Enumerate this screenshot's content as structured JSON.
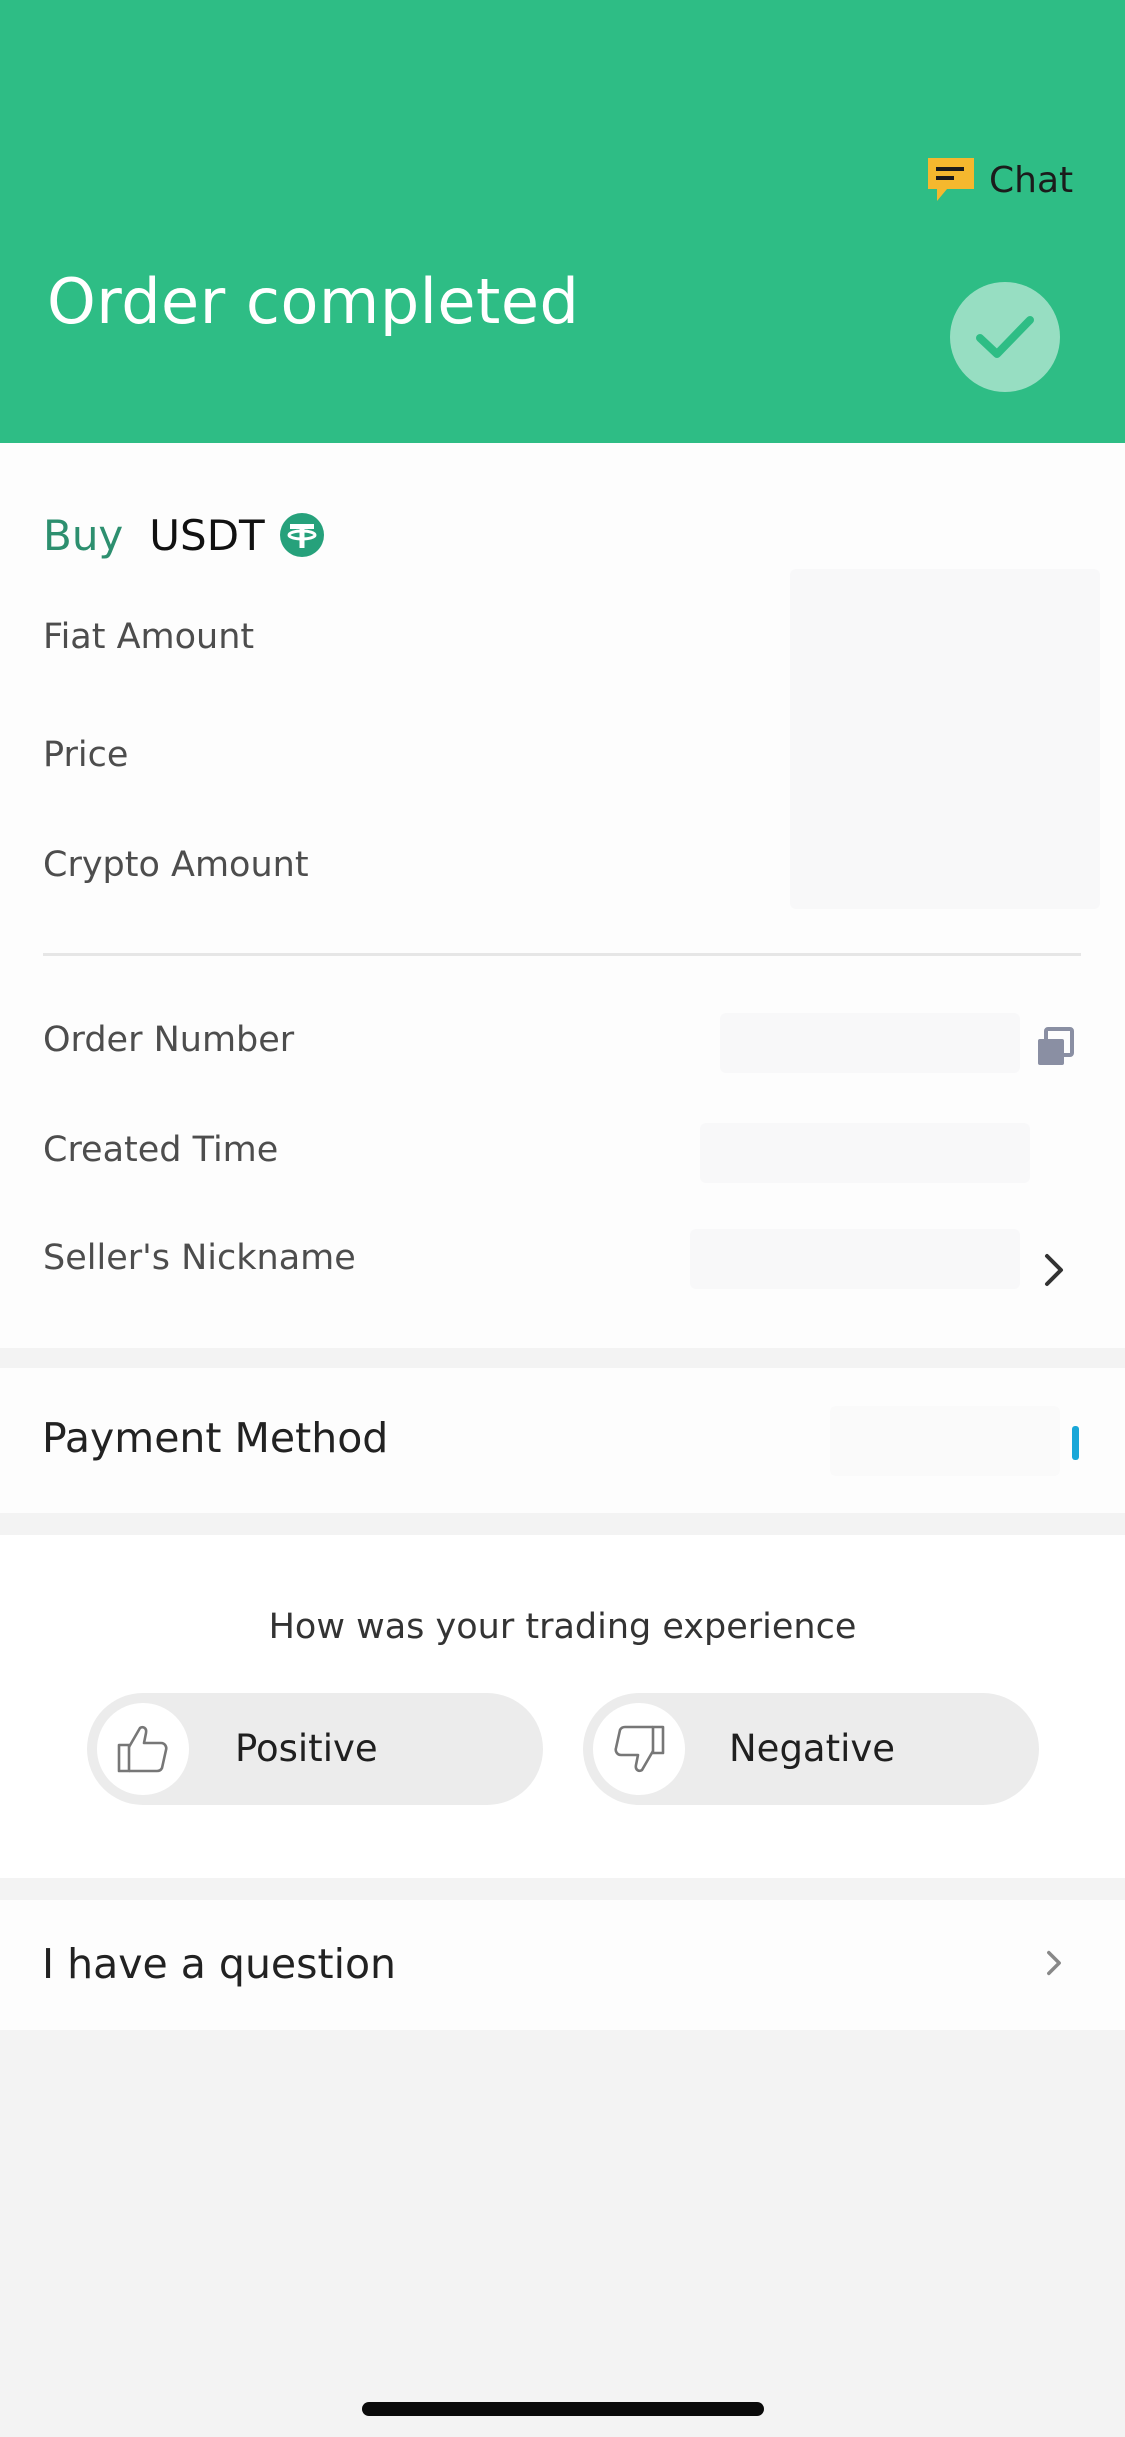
{
  "header": {
    "title": "Order completed",
    "chat_label": "Chat",
    "chat_icon": "chat-bubble-icon",
    "status_icon": "check-icon",
    "background": "#2ebd85"
  },
  "order": {
    "side": "Buy",
    "asset": "USDT",
    "asset_icon": "tether-icon",
    "fields": {
      "fiat_amount": "Fiat Amount",
      "price": "Price",
      "crypto_amount": "Crypto Amount",
      "order_number": "Order Number",
      "created_time": "Created Time",
      "seller_nickname": "Seller's Nickname"
    }
  },
  "payment": {
    "title": "Payment Method",
    "accent": "#19a7d8"
  },
  "feedback": {
    "question": "How was your trading experience",
    "positive_label": "Positive",
    "negative_label": "Negative"
  },
  "support": {
    "question_label": "I have a question"
  },
  "colors": {
    "brand_green": "#2ebd85",
    "buy_green": "#2d8f6f",
    "chat_yellow": "#f5b82e"
  }
}
